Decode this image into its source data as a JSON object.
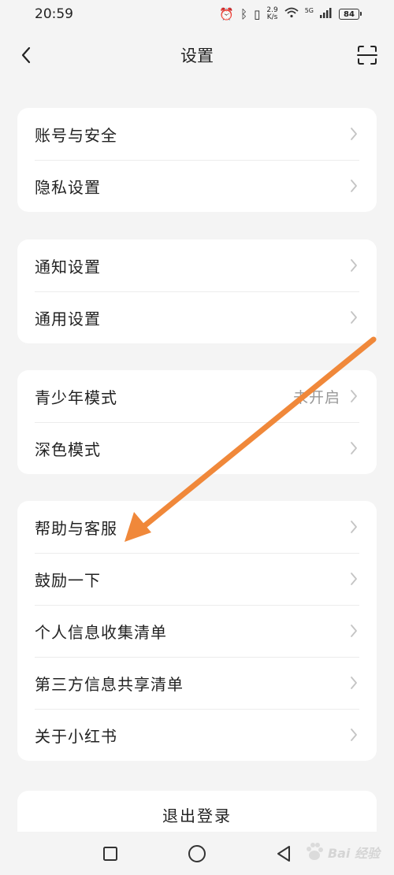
{
  "status_bar": {
    "time": "20:59",
    "net_speed_value": "2.9",
    "net_speed_unit": "K/s",
    "signal_label": "5G",
    "battery": "84"
  },
  "header": {
    "title": "设置"
  },
  "groups": [
    {
      "items": [
        {
          "label": "账号与安全"
        },
        {
          "label": "隐私设置"
        }
      ]
    },
    {
      "items": [
        {
          "label": "通知设置"
        },
        {
          "label": "通用设置"
        }
      ]
    },
    {
      "items": [
        {
          "label": "青少年模式",
          "value": "未开启"
        },
        {
          "label": "深色模式"
        }
      ]
    },
    {
      "items": [
        {
          "label": "帮助与客服"
        },
        {
          "label": "鼓励一下"
        },
        {
          "label": "个人信息收集清单"
        },
        {
          "label": "第三方信息共享清单"
        },
        {
          "label": "关于小红书"
        }
      ]
    }
  ],
  "logout": {
    "label": "退出登录"
  },
  "watermark": {
    "text": "Bai 经验"
  },
  "colors": {
    "background": "#f4f4f4",
    "card": "#ffffff",
    "arrow": "#f0883a",
    "secondary_text": "#999999"
  }
}
